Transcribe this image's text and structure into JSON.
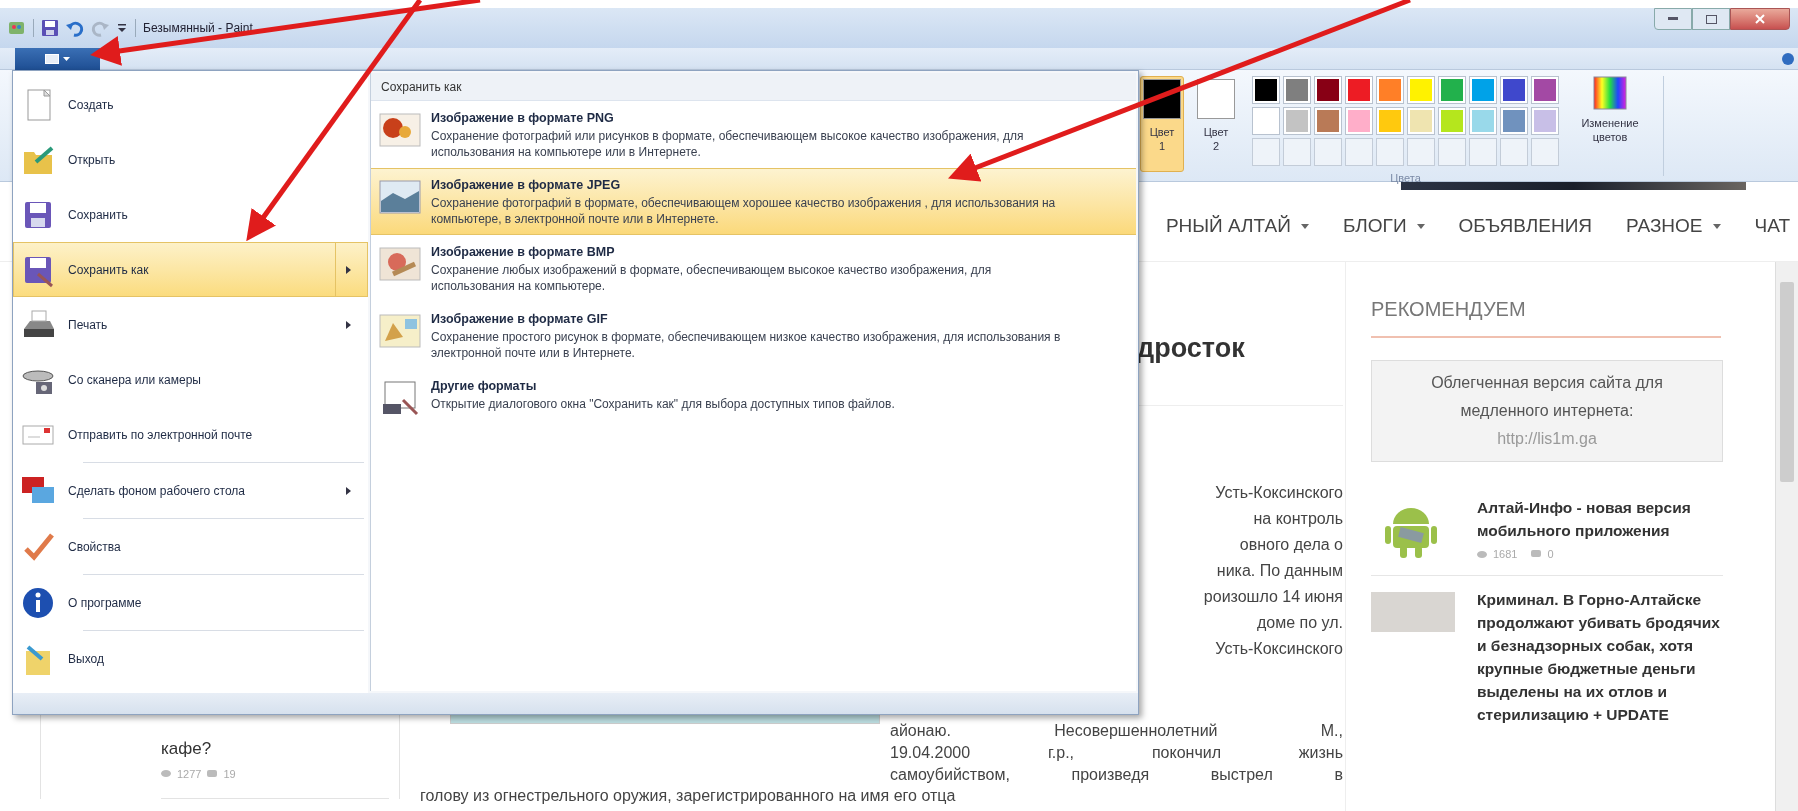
{
  "window": {
    "title": "Безымянный - Paint"
  },
  "file_menu": {
    "items": [
      {
        "label": "Создать",
        "selected": false,
        "has_submenu": false,
        "separator_before": false
      },
      {
        "label": "Открыть",
        "selected": false,
        "has_submenu": false,
        "separator_before": false
      },
      {
        "label": "Сохранить",
        "selected": false,
        "has_submenu": false,
        "separator_before": false
      },
      {
        "label": "Сохранить как",
        "selected": true,
        "has_submenu": true,
        "separator_before": false
      },
      {
        "label": "Печать",
        "selected": false,
        "has_submenu": true,
        "separator_before": false
      },
      {
        "label": "Со сканера или камеры",
        "selected": false,
        "has_submenu": false,
        "separator_before": false
      },
      {
        "label": "Отправить по электронной почте",
        "selected": false,
        "has_submenu": false,
        "separator_before": false
      },
      {
        "label": "Сделать фоном рабочего стола",
        "selected": false,
        "has_submenu": true,
        "separator_before": true
      },
      {
        "label": "Свойства",
        "selected": false,
        "has_submenu": false,
        "separator_before": true
      },
      {
        "label": "О программе",
        "selected": false,
        "has_submenu": false,
        "separator_before": true
      },
      {
        "label": "Выход",
        "selected": false,
        "has_submenu": false,
        "separator_before": true
      }
    ]
  },
  "save_as_submenu": {
    "title": "Сохранить как",
    "items": [
      {
        "title": "Изображение в формате PNG",
        "description": "Сохранение фотографий или рисунков в формате, обеспечивающем высокое качество изображения, для использования на компьютере или в Интернете.",
        "selected": false
      },
      {
        "title": "Изображение в формате JPEG",
        "description": "Сохранение фотографий в формате, обеспечивающем хорошее качество изображения , для использования на компьютере, в электронной почте или в Интернете.",
        "selected": true
      },
      {
        "title": "Изображение в формате BMP",
        "description": "Сохранение любых изображений в формате, обеспечивающем высокое качество изображения, для использования на компьютере.",
        "selected": false
      },
      {
        "title": "Изображение в формате GIF",
        "description": "Сохранение простого рисунок в формате, обеспечивающем низкое качество изображения, для использования в электронной почте или в Интернете.",
        "selected": false
      },
      {
        "title": "Другие форматы",
        "description": "Открытие диалогового окна \"Сохранить как\" для выбора доступных типов файлов.",
        "selected": false
      }
    ]
  },
  "ribbon": {
    "color_slots": [
      {
        "label": "Цвет 1",
        "color": "#000000",
        "selected": true
      },
      {
        "label": "Цвет 2",
        "color": "#ffffff",
        "selected": false
      }
    ],
    "palette": [
      {
        "color": "#000000"
      },
      {
        "color": "#7f7f7f"
      },
      {
        "color": "#880015"
      },
      {
        "color": "#ed1c24"
      },
      {
        "color": "#ff7f27"
      },
      {
        "color": "#fff200"
      },
      {
        "color": "#22b14c"
      },
      {
        "color": "#00a2e8"
      },
      {
        "color": "#3f48cc"
      },
      {
        "color": "#a349a4"
      },
      {
        "color": "#ffffff"
      },
      {
        "color": "#c3c3c3"
      },
      {
        "color": "#b97a57"
      },
      {
        "color": "#ffaec9"
      },
      {
        "color": "#ffc90e"
      },
      {
        "color": "#efe4b0"
      },
      {
        "color": "#b5e61d"
      },
      {
        "color": "#99d9ea"
      },
      {
        "color": "#7092be"
      },
      {
        "color": "#c8bfe7"
      }
    ],
    "edit_colors_label": "Изменение цветов",
    "group_label": "Цвета"
  },
  "web_page": {
    "nav": [
      {
        "label": "РНЫЙ АЛТАЙ",
        "dropdown": true
      },
      {
        "label": "БЛОГИ",
        "dropdown": true
      },
      {
        "label": "ОБЪЯВЛЕНИЯ",
        "dropdown": false
      },
      {
        "label": "РАЗНОЕ",
        "dropdown": true
      },
      {
        "label": "ЧАТ",
        "dropdown": false
      }
    ],
    "left_sidebar": {
      "title": "кафе?",
      "views": "1277",
      "comments": "19"
    },
    "article": {
      "title": "дросток",
      "lines": [
        "Усть-Коксинского",
        "на контроль",
        "овного дела о",
        "ника. По данным",
        "роизошло 14 июня",
        "доме по ул.",
        "Усть-Коксинского"
      ],
      "lines_below": [
        "айонаю. Несовершеннолетний М.,",
        "19.04.2000 г.р., покончил жизнь",
        "самоубийством, произведя выстрел в"
      ],
      "last_line": "голову из огнестрельного оружия, зарегистрированного на имя его отца"
    },
    "right_sidebar": {
      "heading": "РЕКОМЕНДУЕМ",
      "notice": "Облегченная версия сайта для медленного интернета:",
      "notice_link": "http://lis1m.ga",
      "items": [
        {
          "title": "Алтай-Инфо - новая версия мобильного приложения",
          "views": "1681",
          "comments": "0"
        },
        {
          "title": "Криминал. В Горно-Алтайске продолжают убивать бродячих и безнадзорных собак, хотя крупные бюджетные деньги выделены на их отлов и стерилизацию + UPDATE"
        }
      ]
    }
  }
}
